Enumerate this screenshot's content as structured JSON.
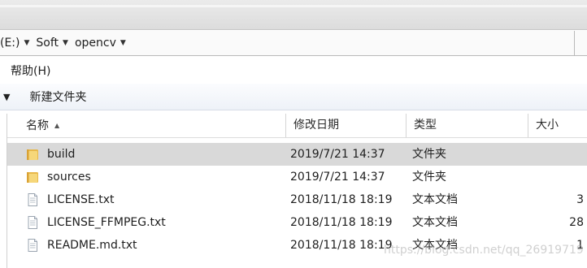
{
  "address": {
    "crumbs": [
      {
        "label": "(E:)"
      },
      {
        "label": "Soft"
      },
      {
        "label": "opencv"
      }
    ]
  },
  "menu": {
    "help": "帮助(H)"
  },
  "toolbar": {
    "new_folder": "新建文件夹"
  },
  "columns": {
    "name": "名称",
    "date": "修改日期",
    "type": "类型",
    "size": "大小"
  },
  "files": [
    {
      "name": "build",
      "date": "2019/7/21 14:37",
      "type": "文件夹",
      "size": "",
      "icon": "folder-icon",
      "selected": true
    },
    {
      "name": "sources",
      "date": "2019/7/21 14:37",
      "type": "文件夹",
      "size": "",
      "icon": "folder-icon",
      "selected": false
    },
    {
      "name": "LICENSE.txt",
      "date": "2018/11/18 18:19",
      "type": "文本文档",
      "size": "3",
      "icon": "text-file-icon",
      "selected": false
    },
    {
      "name": "LICENSE_FFMPEG.txt",
      "date": "2018/11/18 18:19",
      "type": "文本文档",
      "size": "28",
      "icon": "text-file-icon",
      "selected": false
    },
    {
      "name": "README.md.txt",
      "date": "2018/11/18 18:19",
      "type": "文本文档",
      "size": "1",
      "icon": "text-file-icon",
      "selected": false
    }
  ],
  "watermark": "https://blog.csdn.net/qq_26919719",
  "colors": {
    "selected_row": "#d9d9d9",
    "folder_yellow": "#f0c75e",
    "toolbar_bg": "#eef2f8"
  }
}
